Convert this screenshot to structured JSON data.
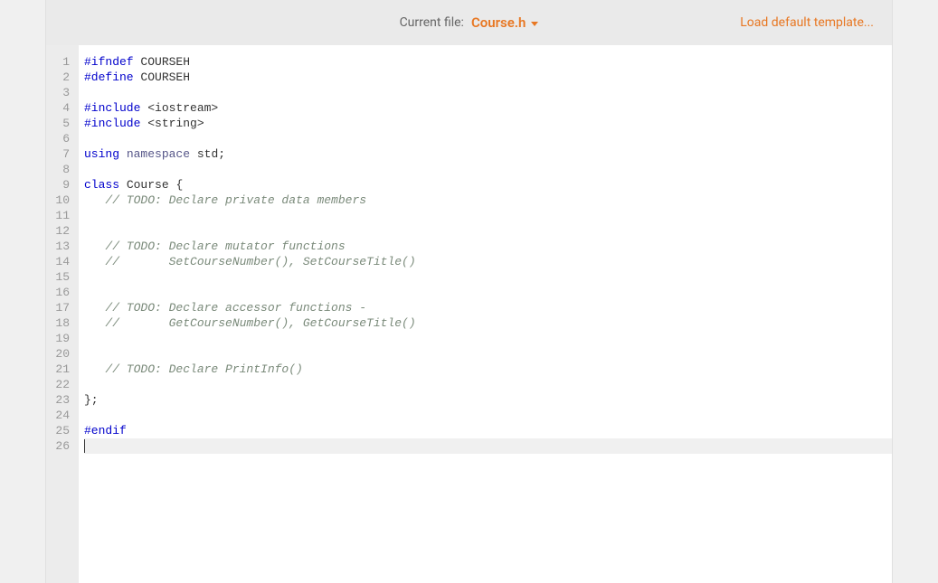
{
  "header": {
    "current_file_label": "Current file:",
    "current_file_name": "Course.h",
    "load_template": "Load default template..."
  },
  "editor": {
    "line_count": 26,
    "current_line": 26,
    "lines": [
      {
        "tokens": [
          {
            "t": "#ifndef",
            "c": "tok-directive"
          },
          {
            "t": " COURSEH",
            "c": "tok-identifier"
          }
        ]
      },
      {
        "tokens": [
          {
            "t": "#define",
            "c": "tok-directive"
          },
          {
            "t": " COURSEH",
            "c": "tok-identifier"
          }
        ]
      },
      {
        "tokens": []
      },
      {
        "tokens": [
          {
            "t": "#include",
            "c": "tok-directive"
          },
          {
            "t": " <iostream>",
            "c": "tok-identifier"
          }
        ]
      },
      {
        "tokens": [
          {
            "t": "#include",
            "c": "tok-directive"
          },
          {
            "t": " <string>",
            "c": "tok-identifier"
          }
        ]
      },
      {
        "tokens": []
      },
      {
        "tokens": [
          {
            "t": "using",
            "c": "tok-keyword"
          },
          {
            "t": " ",
            "c": ""
          },
          {
            "t": "namespace",
            "c": "tok-type"
          },
          {
            "t": " std",
            "c": "tok-identifier"
          },
          {
            "t": ";",
            "c": "tok-punct"
          }
        ]
      },
      {
        "tokens": []
      },
      {
        "tokens": [
          {
            "t": "class",
            "c": "tok-keyword"
          },
          {
            "t": " Course ",
            "c": "tok-identifier"
          },
          {
            "t": "{",
            "c": "tok-punct"
          }
        ]
      },
      {
        "tokens": [
          {
            "t": "   // TODO: Declare private data members",
            "c": "tok-comment"
          }
        ]
      },
      {
        "tokens": []
      },
      {
        "tokens": []
      },
      {
        "tokens": [
          {
            "t": "   // TODO: Declare mutator functions",
            "c": "tok-comment"
          }
        ]
      },
      {
        "tokens": [
          {
            "t": "   //       SetCourseNumber(), SetCourseTitle()",
            "c": "tok-comment"
          }
        ]
      },
      {
        "tokens": []
      },
      {
        "tokens": []
      },
      {
        "tokens": [
          {
            "t": "   // TODO: Declare accessor functions -",
            "c": "tok-comment"
          }
        ]
      },
      {
        "tokens": [
          {
            "t": "   //       GetCourseNumber(), GetCourseTitle()",
            "c": "tok-comment"
          }
        ]
      },
      {
        "tokens": []
      },
      {
        "tokens": []
      },
      {
        "tokens": [
          {
            "t": "   // TODO: Declare PrintInfo()",
            "c": "tok-comment"
          }
        ]
      },
      {
        "tokens": []
      },
      {
        "tokens": [
          {
            "t": "};",
            "c": "tok-punct"
          }
        ]
      },
      {
        "tokens": []
      },
      {
        "tokens": [
          {
            "t": "#endif",
            "c": "tok-directive"
          }
        ]
      },
      {
        "tokens": [],
        "cursor": true
      }
    ]
  }
}
